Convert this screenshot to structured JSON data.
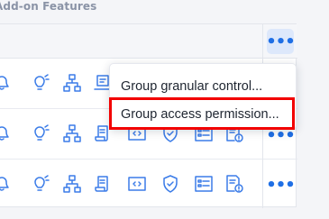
{
  "section": {
    "title": "Add-on Features"
  },
  "menu": {
    "items": [
      {
        "label": "Group granular control..."
      },
      {
        "label": "Group access permission..."
      }
    ]
  },
  "more_button": {
    "glyph": "•••"
  },
  "colors": {
    "accent": "#1f6fe5",
    "icon": "#3b7ce8",
    "highlight": "#f20000",
    "active_button_bg": "#dde8fb"
  },
  "rows": [
    {
      "icons": [
        "bell-icon",
        "bulb-settings-icon",
        "network-icon",
        "laptop-icon"
      ]
    },
    {
      "icons": [
        "bell-icon",
        "bulb-settings-icon",
        "network-icon",
        "script-icon",
        "code-window-icon",
        "shield-icon",
        "list-card-icon",
        "document-alert-icon"
      ]
    },
    {
      "icons": [
        "bell-icon",
        "bulb-settings-icon",
        "network-icon",
        "script-icon",
        "code-window-icon",
        "shield-icon",
        "list-card-icon",
        "document-alert-icon"
      ]
    }
  ]
}
